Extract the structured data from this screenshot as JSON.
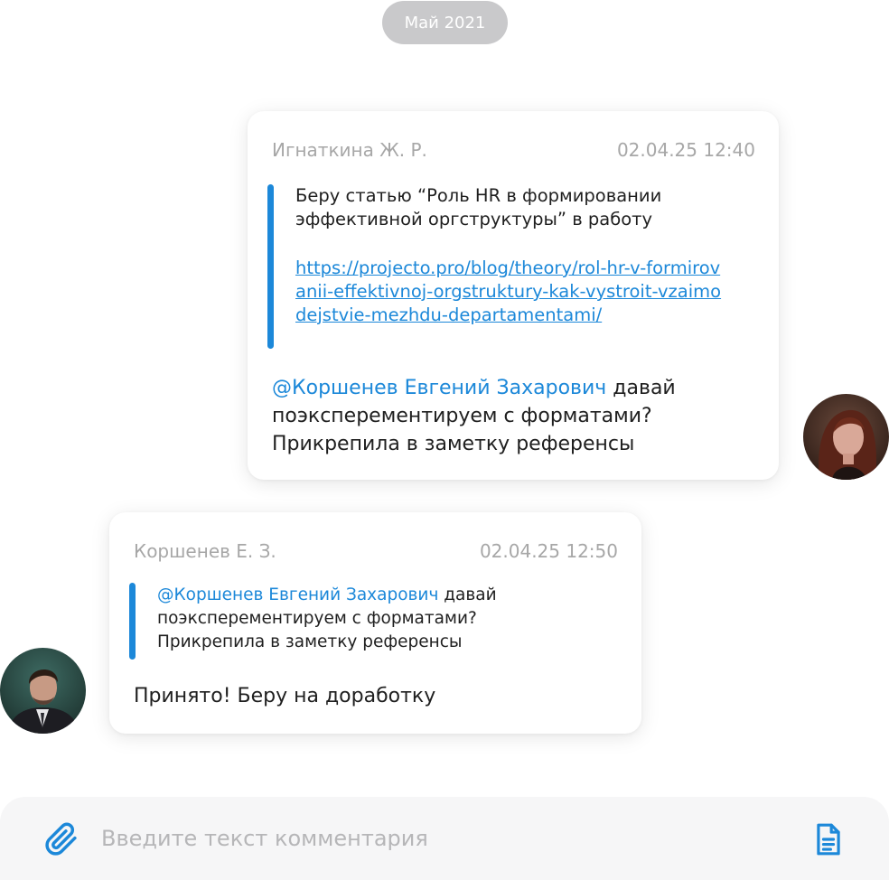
{
  "date_separator": "Май 2021",
  "messages": [
    {
      "author": "Игнаткина Ж. Р.",
      "time": "02.04.25 12:40",
      "quote_text": "Беру статью “Роль HR в формировании эффективной оргструктуры” в работу",
      "quote_link": "https://projecto.pro/blog/theory/rol-hr-v-formirovanii-effektivnoj-orgstruktury-kak-vystroit-vzaimodejstvie-mezhdu-departamentami/",
      "mention": "@Коршенев Евгений Захарович",
      "text": " давай поэксперементируем с форматами? Прикрепила в заметку референсы"
    },
    {
      "author": "Коршенев Е. З.",
      "time": "02.04.25 12:50",
      "quote_mention": "@Коршенев Евгений Захарович",
      "quote_text": " давай поэксперементируем с форматами? Прикрепила в заметку референсы",
      "text": "Принято! Беру на доработку"
    }
  ],
  "composer": {
    "placeholder": "Введите текст комментария",
    "attach_icon": "paperclip-icon",
    "doc_icon": "document-icon"
  },
  "colors": {
    "accent": "#1c88d9",
    "meta_text": "#a7a7a7",
    "pill_bg": "#c9c9cb",
    "composer_bg": "#f6f6f7"
  }
}
